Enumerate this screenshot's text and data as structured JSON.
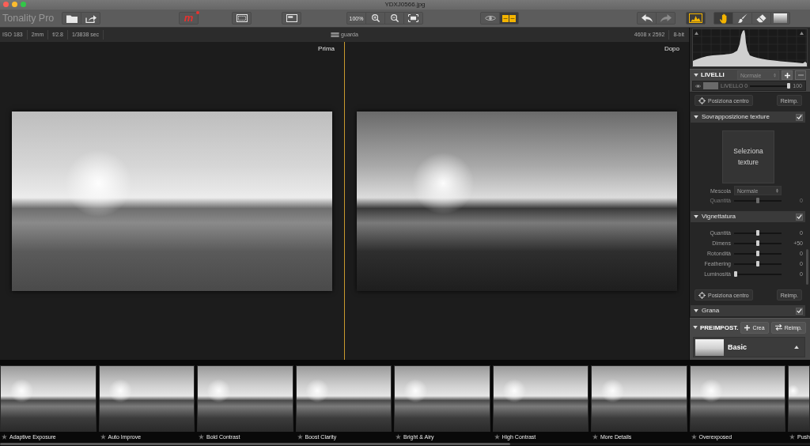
{
  "window": {
    "title": "YDXJ0566.jpg"
  },
  "toolbar": {
    "app_name": "Tonality Pro",
    "badge_button": {
      "label": "m",
      "notification": true
    },
    "zoom_level": "100%",
    "view_modes": [
      {
        "kind": "preview",
        "selected": false
      },
      {
        "kind": "split",
        "selected": true
      }
    ],
    "history": [
      {
        "kind": "undo",
        "disabled": false
      },
      {
        "kind": "redo",
        "disabled": true
      }
    ],
    "histogram_toggle": {
      "on": true
    },
    "tools": [
      {
        "kind": "hand",
        "selected": true
      },
      {
        "kind": "brush",
        "selected": false
      },
      {
        "kind": "eraser",
        "selected": false
      },
      {
        "kind": "gradient",
        "selected": false
      }
    ]
  },
  "info_bar": {
    "exif": [
      "ISO 183",
      "2mm",
      "f/2.8",
      "1/3838 sec"
    ],
    "view_label": "guarda",
    "image_info": [
      "4608 x 2592",
      "8-bit"
    ]
  },
  "canvas": {
    "before_label": "Prima",
    "after_label": "Dopo"
  },
  "panel": {
    "layers": {
      "title": "LIVELLI",
      "expanded": true,
      "blend_mode": "Normale",
      "remove_disabled": true,
      "items": [
        {
          "name": "LIVELLO 0",
          "visible": true,
          "level": 1,
          "opacity": "100"
        }
      ],
      "center_button": "Posiziona centro",
      "reset_button": "Reimp."
    },
    "sections": [
      {
        "kind": "texture",
        "title": "Sovrapposizione texture",
        "expanded": true,
        "checked": true,
        "select_label": "Seleziona texture",
        "blend_label": "Mescola",
        "blend_mode": "Normale",
        "sliders": [
          {
            "label": "Quantità",
            "level": 0.5,
            "value": "0",
            "disabled": true
          }
        ]
      },
      {
        "kind": "vignette",
        "title": "Vignettatura",
        "expanded": true,
        "checked": true,
        "sliders": [
          {
            "label": "Quantità",
            "level": 0.5,
            "value": "0",
            "disabled": false
          },
          {
            "label": "Dimens",
            "level": 0.5,
            "value": "+50",
            "disabled": false
          },
          {
            "label": "Rotondità",
            "level": 0.5,
            "value": "0",
            "disabled": false
          },
          {
            "label": "Feathering",
            "level": 0.5,
            "value": "0",
            "disabled": false
          },
          {
            "label": "Luminosità",
            "level": 0,
            "value": "0",
            "disabled": false
          }
        ],
        "center_button": "Posiziona centro",
        "reset_button": "Reimp."
      },
      {
        "kind": "grain",
        "title": "Grana",
        "expanded": true,
        "checked": true
      }
    ],
    "presets": {
      "title": "PREIMPOST.",
      "expanded": true,
      "create_button": "Crea",
      "reset_button": "Reimp.",
      "current": "Basic"
    }
  },
  "filmstrip": [
    {
      "name": "Adaptive Exposure",
      "starred": false
    },
    {
      "name": "Auto Improve",
      "starred": false
    },
    {
      "name": "Bold Contrast",
      "starred": false
    },
    {
      "name": "Boost Clarity",
      "starred": false
    },
    {
      "name": "Bright & Airy",
      "starred": false
    },
    {
      "name": "High Contrast",
      "starred": false
    },
    {
      "name": "More Details",
      "starred": false
    },
    {
      "name": "Overexposed",
      "starred": false
    },
    {
      "name": "Push",
      "starred": false
    }
  ]
}
